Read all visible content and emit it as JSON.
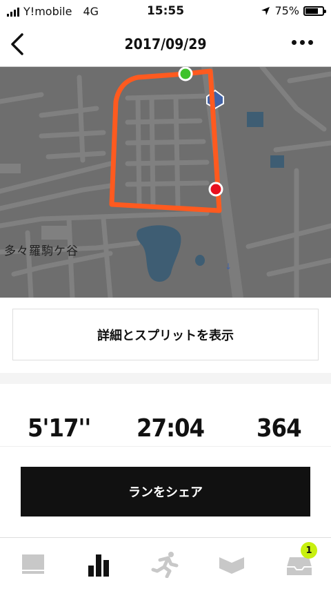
{
  "status_bar": {
    "carrier": "Y!mobile",
    "network": "4G",
    "time": "15:55",
    "battery": "75%",
    "battery_level": 0.75,
    "icons": [
      "signal-icon",
      "location-arrow-icon",
      "battery-icon"
    ]
  },
  "header": {
    "title": "2017/09/29",
    "back_icon": "chevron-left-icon",
    "more_icon": "more-dots-icon"
  },
  "map": {
    "place_label": "多々羅駒ケ谷",
    "route_color": "#ff5a1f",
    "start_marker_color": "#3fc22b",
    "end_marker_color": "#e8101e"
  },
  "detail_button": {
    "label": "詳細とスプリットを表示"
  },
  "stats": {
    "pace": "5'17''",
    "duration": "27:04",
    "calories": "364"
  },
  "share_button": {
    "label": "ランをシェア"
  },
  "tab_bar": {
    "items": [
      {
        "name": "feed",
        "icon": "feed-icon",
        "active": false
      },
      {
        "name": "activity",
        "icon": "bar-chart-icon",
        "active": true
      },
      {
        "name": "run",
        "icon": "runner-icon",
        "active": false
      },
      {
        "name": "club",
        "icon": "chevron-banner-icon",
        "active": false
      },
      {
        "name": "inbox",
        "icon": "inbox-icon",
        "active": false,
        "badge": "1"
      }
    ],
    "badge_color": "#c8f010"
  }
}
